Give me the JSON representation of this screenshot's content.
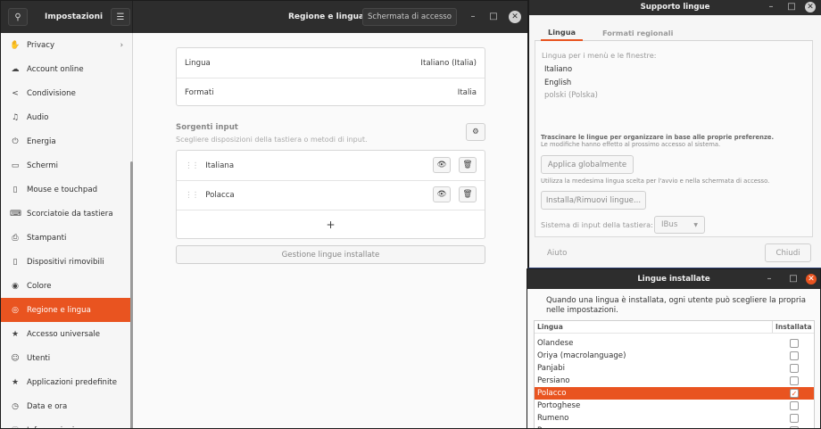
{
  "settings": {
    "app_title": "Impostazioni",
    "page_title": "Regione e lingua",
    "login_screen_button": "Schermata di accesso",
    "sidebar": [
      {
        "label": "Privacy",
        "icon": "hand-icon"
      },
      {
        "label": "Account online",
        "icon": "cloud-icon"
      },
      {
        "label": "Condivisione",
        "icon": "share-icon"
      },
      {
        "label": "Audio",
        "icon": "music-note-icon"
      },
      {
        "label": "Energia",
        "icon": "power-icon"
      },
      {
        "label": "Schermi",
        "icon": "display-icon"
      },
      {
        "label": "Mouse e touchpad",
        "icon": "mouse-icon"
      },
      {
        "label": "Scorciatoie da tastiera",
        "icon": "keyboard-icon"
      },
      {
        "label": "Stampanti",
        "icon": "printer-icon"
      },
      {
        "label": "Dispositivi rimovibili",
        "icon": "usb-icon"
      },
      {
        "label": "Colore",
        "icon": "palette-icon"
      },
      {
        "label": "Regione e lingua",
        "icon": "globe-icon"
      },
      {
        "label": "Accesso universale",
        "icon": "accessibility-icon"
      },
      {
        "label": "Utenti",
        "icon": "user-icon"
      },
      {
        "label": "Applicazioni predefinite",
        "icon": "star-icon"
      },
      {
        "label": "Data e ora",
        "icon": "clock-icon"
      },
      {
        "label": "Informazioni",
        "icon": "info-icon"
      }
    ],
    "language_label": "Lingua",
    "language_value": "Italiano (Italia)",
    "formats_label": "Formati",
    "formats_value": "Italia",
    "input_sources_title": "Sorgenti input",
    "input_sources_subtitle": "Scegliere disposizioni della tastiera o metodi di input.",
    "input_sources": [
      "Italiana",
      "Polacca"
    ],
    "add_symbol": "+",
    "manage_languages_button": "Gestione lingue installate"
  },
  "supporto": {
    "title": "Supporto lingue",
    "tabs": [
      "Lingua",
      "Formati regionali"
    ],
    "menu_label": "Lingua per i menù e le finestre:",
    "languages": [
      "Italiano",
      "English",
      "polski (Polska)"
    ],
    "drag_hint": "Trascinare le lingue per organizzare in base alle proprie preferenze.",
    "drag_subhint": "Le modifiche hanno effetto al prossimo accesso al sistema.",
    "apply_global": "Applica globalmente",
    "apply_hint": "Utilizza la medesima lingua scelta per l'avvio e nella schermata di accesso.",
    "install_remove": "Installa/Rimuovi lingue...",
    "input_system_label": "Sistema di input della tastiera:",
    "input_system_value": "IBus",
    "help": "Aiuto",
    "close": "Chiudi"
  },
  "installate": {
    "title": "Lingue installate",
    "description": "Quando una lingua è installata, ogni utente può scegliere la propria nelle impostazioni.",
    "col_language": "Lingua",
    "col_installed": "Installata",
    "rows": [
      {
        "name": "Olandese",
        "installed": false
      },
      {
        "name": "Oriya (macrolanguage)",
        "installed": false
      },
      {
        "name": "Panjabi",
        "installed": false
      },
      {
        "name": "Persiano",
        "installed": false
      },
      {
        "name": "Polacco",
        "installed": true,
        "selected": true
      },
      {
        "name": "Portoghese",
        "installed": false
      },
      {
        "name": "Rumeno",
        "installed": false
      },
      {
        "name": "Russo",
        "installed": false
      }
    ]
  },
  "colors": {
    "accent": "#e95420",
    "titlebar": "#2d2d2d"
  }
}
